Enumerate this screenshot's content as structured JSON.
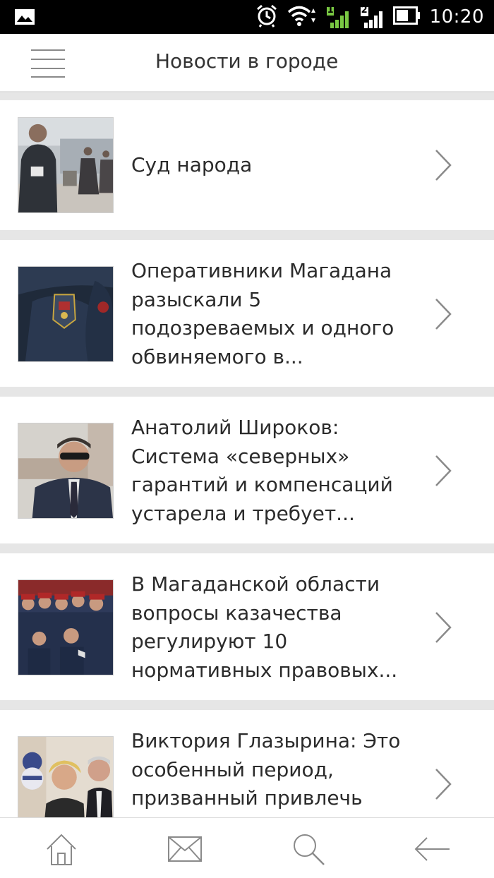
{
  "status_bar": {
    "time": "10:20",
    "icons": [
      "gallery-icon",
      "alarm-icon",
      "wifi-icon",
      "signal-sim1-icon",
      "signal-sim2-icon",
      "battery-icon"
    ],
    "sim1_label": "1",
    "sim2_label": "2"
  },
  "header": {
    "title": "Новости в городе",
    "menu_icon": "hamburger-menu-icon"
  },
  "news": [
    {
      "title": "Суд народа"
    },
    {
      "title": "Оперативники Магадана разыскали 5 подозреваемых и одного обвиняемого в..."
    },
    {
      "title": "Анатолий Широков: Система «северных» гарантий и компенсаций устарела и требует..."
    },
    {
      "title": "В Магаданской области вопросы казачества регулируют 10 нормативных правовых..."
    },
    {
      "title": "Виктория Глазырина: Это особенный период, призванный привлечь"
    }
  ],
  "bottom_nav": {
    "items": [
      "home-icon",
      "mail-icon",
      "search-icon",
      "back-arrow-icon"
    ]
  },
  "colors": {
    "status_bar": "#000000",
    "header_bg": "#ffffff",
    "separator": "#e6e6e6",
    "text": "#2b2b2b",
    "icon_gray": "#8a8a8a",
    "signal_green": "#7ac943"
  }
}
